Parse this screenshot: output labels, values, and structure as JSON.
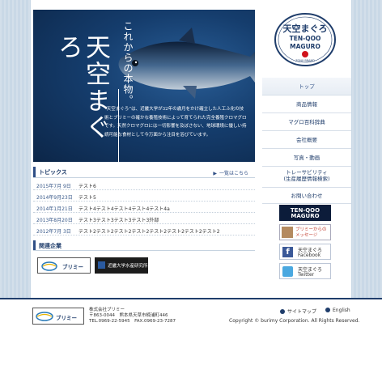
{
  "hero": {
    "title": "天空まぐろ",
    "subtitle": "これからの本物。",
    "body": "“天空まぐろ”は、近畿大学が32年の歳月をかけ確立した人工ふ化の技術とブリミーの確かな養殖技術によって育てられた完全養殖クロマグロです。天然クロマグロには一切影響を及ぼさない、地球環境に優しい持続可能な食材として今万面から注目を浴びています。"
  },
  "topics": {
    "heading": "トピックス",
    "more_label": "一覧はこちら",
    "items": [
      {
        "date": "2015年7月 9日",
        "text": "テスト6"
      },
      {
        "date": "2014年9月23日",
        "text": "テスト5"
      },
      {
        "date": "2014年1月21日",
        "text": "テスト4テスト4テスト4テスト4テスト4a"
      },
      {
        "date": "2013年8月20日",
        "text": "テスト3テスト3テスト3テスト3外部"
      },
      {
        "date": "2012年7月 3日",
        "text": "テスト2テスト2テスト2テスト2テスト2テスト2テスト2テスト2"
      }
    ]
  },
  "related": {
    "heading": "関連企業",
    "items": [
      {
        "label": "ブリミー"
      },
      {
        "label": "近畿大学水産研究所"
      }
    ]
  },
  "logo": {
    "top": "天空まぐろ",
    "middle": "TEN-QOO",
    "bottom": "MAGURO",
    "small": "ZONX BRAND"
  },
  "nav": [
    {
      "label": "トップ",
      "active": true
    },
    {
      "label": "商品情報"
    },
    {
      "label": "マグロ百科辞典"
    },
    {
      "label": "会社概要"
    },
    {
      "label": "写真・動画"
    },
    {
      "label": "トレーサビリティ\n(生産履歴情報検索)"
    },
    {
      "label": "お問い合わせ"
    }
  ],
  "banners": {
    "maguro": "TEN-QOO MAGURO",
    "message": "ブリミーからのメッセージ",
    "facebook_top": "天空まぐろ",
    "facebook_bottom": "Facebook",
    "twitter_top": "天空まぐろ",
    "twitter_bottom": "Twitter"
  },
  "footer": {
    "logo": "ブリミー",
    "company": "株式会社ブリミー",
    "address": "〒863-0044　熊本県天草市楠浦町446",
    "tel": "TEL.0969-22-5945　FAX.0969-23-7287",
    "sitemap": "サイトマップ",
    "english": "English",
    "copyright": "Copyright © burimy Corporation. All Rights Reserved."
  },
  "colors": {
    "navy": "#1f3d6b",
    "accent": "#2f4f86",
    "sky": "#c9d8e6"
  }
}
